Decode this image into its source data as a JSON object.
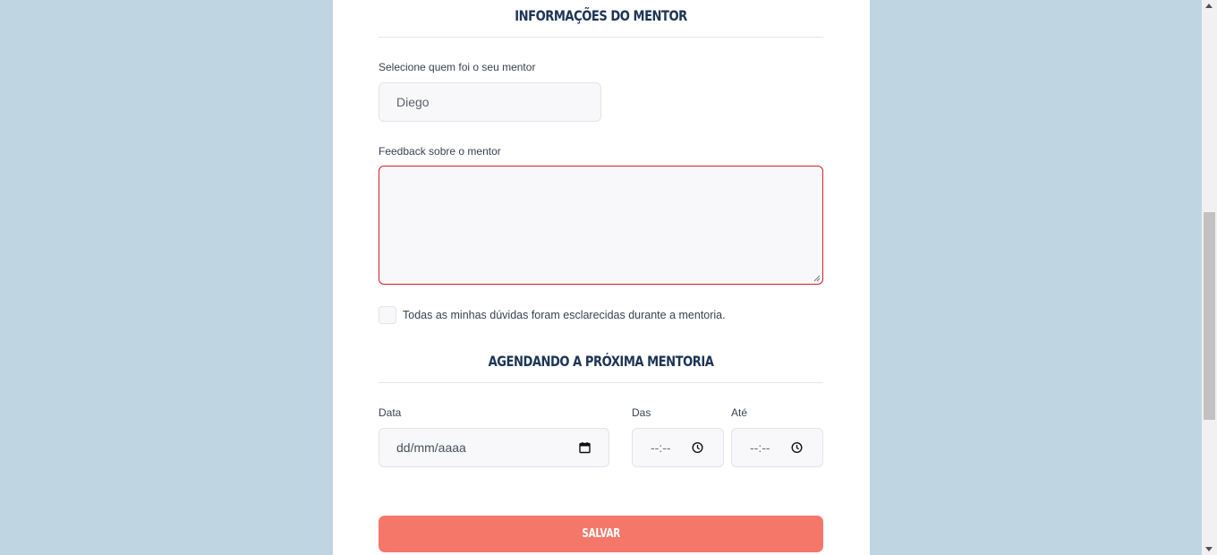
{
  "mentor_section": {
    "title": "INFORMAÇÕES DO MENTOR",
    "mentor_label": "Selecione quem foi o seu mentor",
    "mentor_value": "Diego",
    "feedback_label": "Feedback sobre o mentor",
    "feedback_value": "",
    "checkbox_label": "Todas as minhas dúvidas foram esclarecidas durante a mentoria."
  },
  "schedule_section": {
    "title": "AGENDANDO A PRÓXIMA MENTORIA",
    "date_label": "Data",
    "date_placeholder": "dd/mm/aaaa",
    "from_label": "Das",
    "from_placeholder": "--:--",
    "to_label": "Até",
    "to_placeholder": "--:--"
  },
  "save_label": "SALVAR",
  "colors": {
    "background": "#bfd6e2",
    "title": "#1d3557",
    "error_border": "#d0212b",
    "save_button": "#f4776a"
  },
  "icons": {
    "date": "calendar-icon",
    "time": "clock-icon"
  }
}
